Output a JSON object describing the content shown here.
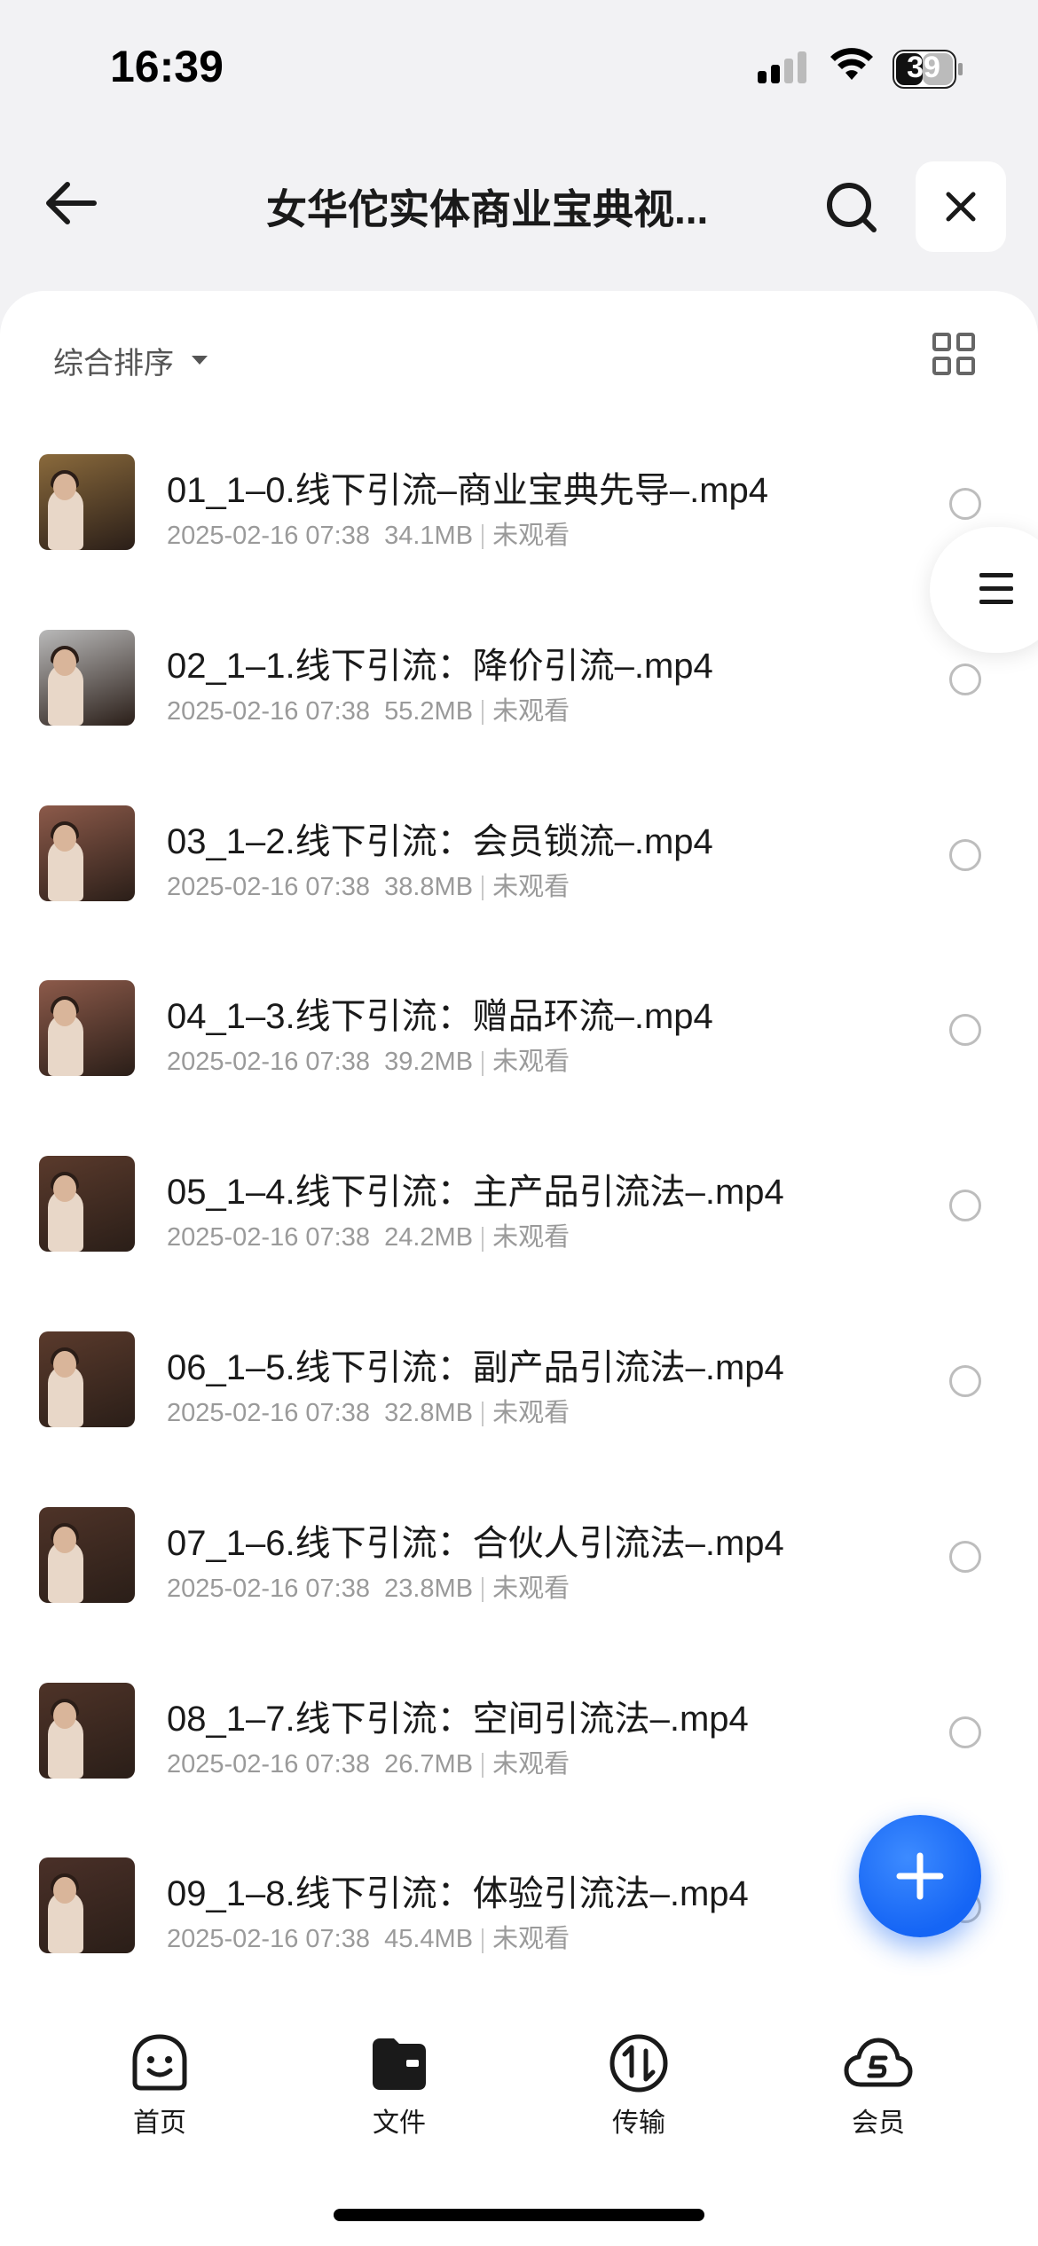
{
  "status_bar": {
    "time": "16:39",
    "battery_level": "39"
  },
  "nav": {
    "title": "女华佗实体商业宝典视..."
  },
  "sort": {
    "label": "综合排序"
  },
  "files": [
    {
      "name": "01_1–0.线下引流–商业宝典先导–.mp4",
      "date": "2025-02-16 07:38",
      "size": "34.1MB",
      "status": "未观看",
      "thumb_bg": "#8a6a3c"
    },
    {
      "name": "02_1–1.线下引流：降价引流–.mp4",
      "date": "2025-02-16 07:38",
      "size": "55.2MB",
      "status": "未观看",
      "thumb_bg": "#b9b9b9"
    },
    {
      "name": "03_1–2.线下引流：会员锁流–.mp4",
      "date": "2025-02-16 07:38",
      "size": "38.8MB",
      "status": "未观看",
      "thumb_bg": "#8c5a4a"
    },
    {
      "name": "04_1–3.线下引流：赠品环流–.mp4",
      "date": "2025-02-16 07:38",
      "size": "39.2MB",
      "status": "未观看",
      "thumb_bg": "#8c5a4a"
    },
    {
      "name": "05_1–4.线下引流：主产品引流法–.mp4",
      "date": "2025-02-16 07:38",
      "size": "24.2MB",
      "status": "未观看",
      "thumb_bg": "#5a3a2c"
    },
    {
      "name": "06_1–5.线下引流：副产品引流法–.mp4",
      "date": "2025-02-16 07:38",
      "size": "32.8MB",
      "status": "未观看",
      "thumb_bg": "#5a3a2c"
    },
    {
      "name": "07_1–6.线下引流：合伙人引流法–.mp4",
      "date": "2025-02-16 07:38",
      "size": "23.8MB",
      "status": "未观看",
      "thumb_bg": "#4e3328"
    },
    {
      "name": "08_1–7.线下引流：空间引流法–.mp4",
      "date": "2025-02-16 07:38",
      "size": "26.7MB",
      "status": "未观看",
      "thumb_bg": "#4e3328"
    },
    {
      "name": "09_1–8.线下引流：体验引流法–.mp4",
      "date": "2025-02-16 07:38",
      "size": "45.4MB",
      "status": "未观看",
      "thumb_bg": "#4a3028"
    }
  ],
  "tabs": [
    {
      "label": "首页",
      "icon": "home-smile-icon"
    },
    {
      "label": "文件",
      "icon": "folder-icon"
    },
    {
      "label": "传输",
      "icon": "transfer-icon"
    },
    {
      "label": "会员",
      "icon": "vip-cloud-icon"
    }
  ],
  "colors": {
    "accent": "#1565f5",
    "background": "#f2f2f4",
    "meta_text": "#9a9a9a"
  }
}
